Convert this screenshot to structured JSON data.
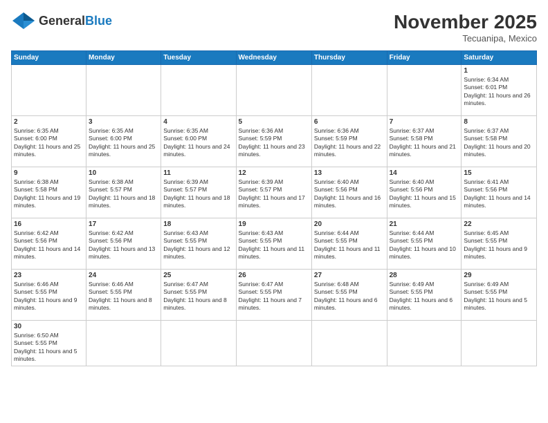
{
  "header": {
    "logo_general": "General",
    "logo_blue": "Blue",
    "month_title": "November 2025",
    "location": "Tecuanipa, Mexico"
  },
  "days_of_week": [
    "Sunday",
    "Monday",
    "Tuesday",
    "Wednesday",
    "Thursday",
    "Friday",
    "Saturday"
  ],
  "weeks": [
    [
      {
        "day": "",
        "info": ""
      },
      {
        "day": "",
        "info": ""
      },
      {
        "day": "",
        "info": ""
      },
      {
        "day": "",
        "info": ""
      },
      {
        "day": "",
        "info": ""
      },
      {
        "day": "",
        "info": ""
      },
      {
        "day": "1",
        "info": "Sunrise: 6:34 AM\nSunset: 6:01 PM\nDaylight: 11 hours and 26 minutes."
      }
    ],
    [
      {
        "day": "2",
        "info": "Sunrise: 6:35 AM\nSunset: 6:00 PM\nDaylight: 11 hours and 25 minutes."
      },
      {
        "day": "3",
        "info": "Sunrise: 6:35 AM\nSunset: 6:00 PM\nDaylight: 11 hours and 25 minutes."
      },
      {
        "day": "4",
        "info": "Sunrise: 6:35 AM\nSunset: 6:00 PM\nDaylight: 11 hours and 24 minutes."
      },
      {
        "day": "5",
        "info": "Sunrise: 6:36 AM\nSunset: 5:59 PM\nDaylight: 11 hours and 23 minutes."
      },
      {
        "day": "6",
        "info": "Sunrise: 6:36 AM\nSunset: 5:59 PM\nDaylight: 11 hours and 22 minutes."
      },
      {
        "day": "7",
        "info": "Sunrise: 6:37 AM\nSunset: 5:58 PM\nDaylight: 11 hours and 21 minutes."
      },
      {
        "day": "8",
        "info": "Sunrise: 6:37 AM\nSunset: 5:58 PM\nDaylight: 11 hours and 20 minutes."
      }
    ],
    [
      {
        "day": "9",
        "info": "Sunrise: 6:38 AM\nSunset: 5:58 PM\nDaylight: 11 hours and 19 minutes."
      },
      {
        "day": "10",
        "info": "Sunrise: 6:38 AM\nSunset: 5:57 PM\nDaylight: 11 hours and 18 minutes."
      },
      {
        "day": "11",
        "info": "Sunrise: 6:39 AM\nSunset: 5:57 PM\nDaylight: 11 hours and 18 minutes."
      },
      {
        "day": "12",
        "info": "Sunrise: 6:39 AM\nSunset: 5:57 PM\nDaylight: 11 hours and 17 minutes."
      },
      {
        "day": "13",
        "info": "Sunrise: 6:40 AM\nSunset: 5:56 PM\nDaylight: 11 hours and 16 minutes."
      },
      {
        "day": "14",
        "info": "Sunrise: 6:40 AM\nSunset: 5:56 PM\nDaylight: 11 hours and 15 minutes."
      },
      {
        "day": "15",
        "info": "Sunrise: 6:41 AM\nSunset: 5:56 PM\nDaylight: 11 hours and 14 minutes."
      }
    ],
    [
      {
        "day": "16",
        "info": "Sunrise: 6:42 AM\nSunset: 5:56 PM\nDaylight: 11 hours and 14 minutes."
      },
      {
        "day": "17",
        "info": "Sunrise: 6:42 AM\nSunset: 5:56 PM\nDaylight: 11 hours and 13 minutes."
      },
      {
        "day": "18",
        "info": "Sunrise: 6:43 AM\nSunset: 5:55 PM\nDaylight: 11 hours and 12 minutes."
      },
      {
        "day": "19",
        "info": "Sunrise: 6:43 AM\nSunset: 5:55 PM\nDaylight: 11 hours and 11 minutes."
      },
      {
        "day": "20",
        "info": "Sunrise: 6:44 AM\nSunset: 5:55 PM\nDaylight: 11 hours and 11 minutes."
      },
      {
        "day": "21",
        "info": "Sunrise: 6:44 AM\nSunset: 5:55 PM\nDaylight: 11 hours and 10 minutes."
      },
      {
        "day": "22",
        "info": "Sunrise: 6:45 AM\nSunset: 5:55 PM\nDaylight: 11 hours and 9 minutes."
      }
    ],
    [
      {
        "day": "23",
        "info": "Sunrise: 6:46 AM\nSunset: 5:55 PM\nDaylight: 11 hours and 9 minutes."
      },
      {
        "day": "24",
        "info": "Sunrise: 6:46 AM\nSunset: 5:55 PM\nDaylight: 11 hours and 8 minutes."
      },
      {
        "day": "25",
        "info": "Sunrise: 6:47 AM\nSunset: 5:55 PM\nDaylight: 11 hours and 8 minutes."
      },
      {
        "day": "26",
        "info": "Sunrise: 6:47 AM\nSunset: 5:55 PM\nDaylight: 11 hours and 7 minutes."
      },
      {
        "day": "27",
        "info": "Sunrise: 6:48 AM\nSunset: 5:55 PM\nDaylight: 11 hours and 6 minutes."
      },
      {
        "day": "28",
        "info": "Sunrise: 6:49 AM\nSunset: 5:55 PM\nDaylight: 11 hours and 6 minutes."
      },
      {
        "day": "29",
        "info": "Sunrise: 6:49 AM\nSunset: 5:55 PM\nDaylight: 11 hours and 5 minutes."
      }
    ],
    [
      {
        "day": "30",
        "info": "Sunrise: 6:50 AM\nSunset: 5:55 PM\nDaylight: 11 hours and 5 minutes."
      },
      {
        "day": "",
        "info": ""
      },
      {
        "day": "",
        "info": ""
      },
      {
        "day": "",
        "info": ""
      },
      {
        "day": "",
        "info": ""
      },
      {
        "day": "",
        "info": ""
      },
      {
        "day": "",
        "info": ""
      }
    ]
  ]
}
